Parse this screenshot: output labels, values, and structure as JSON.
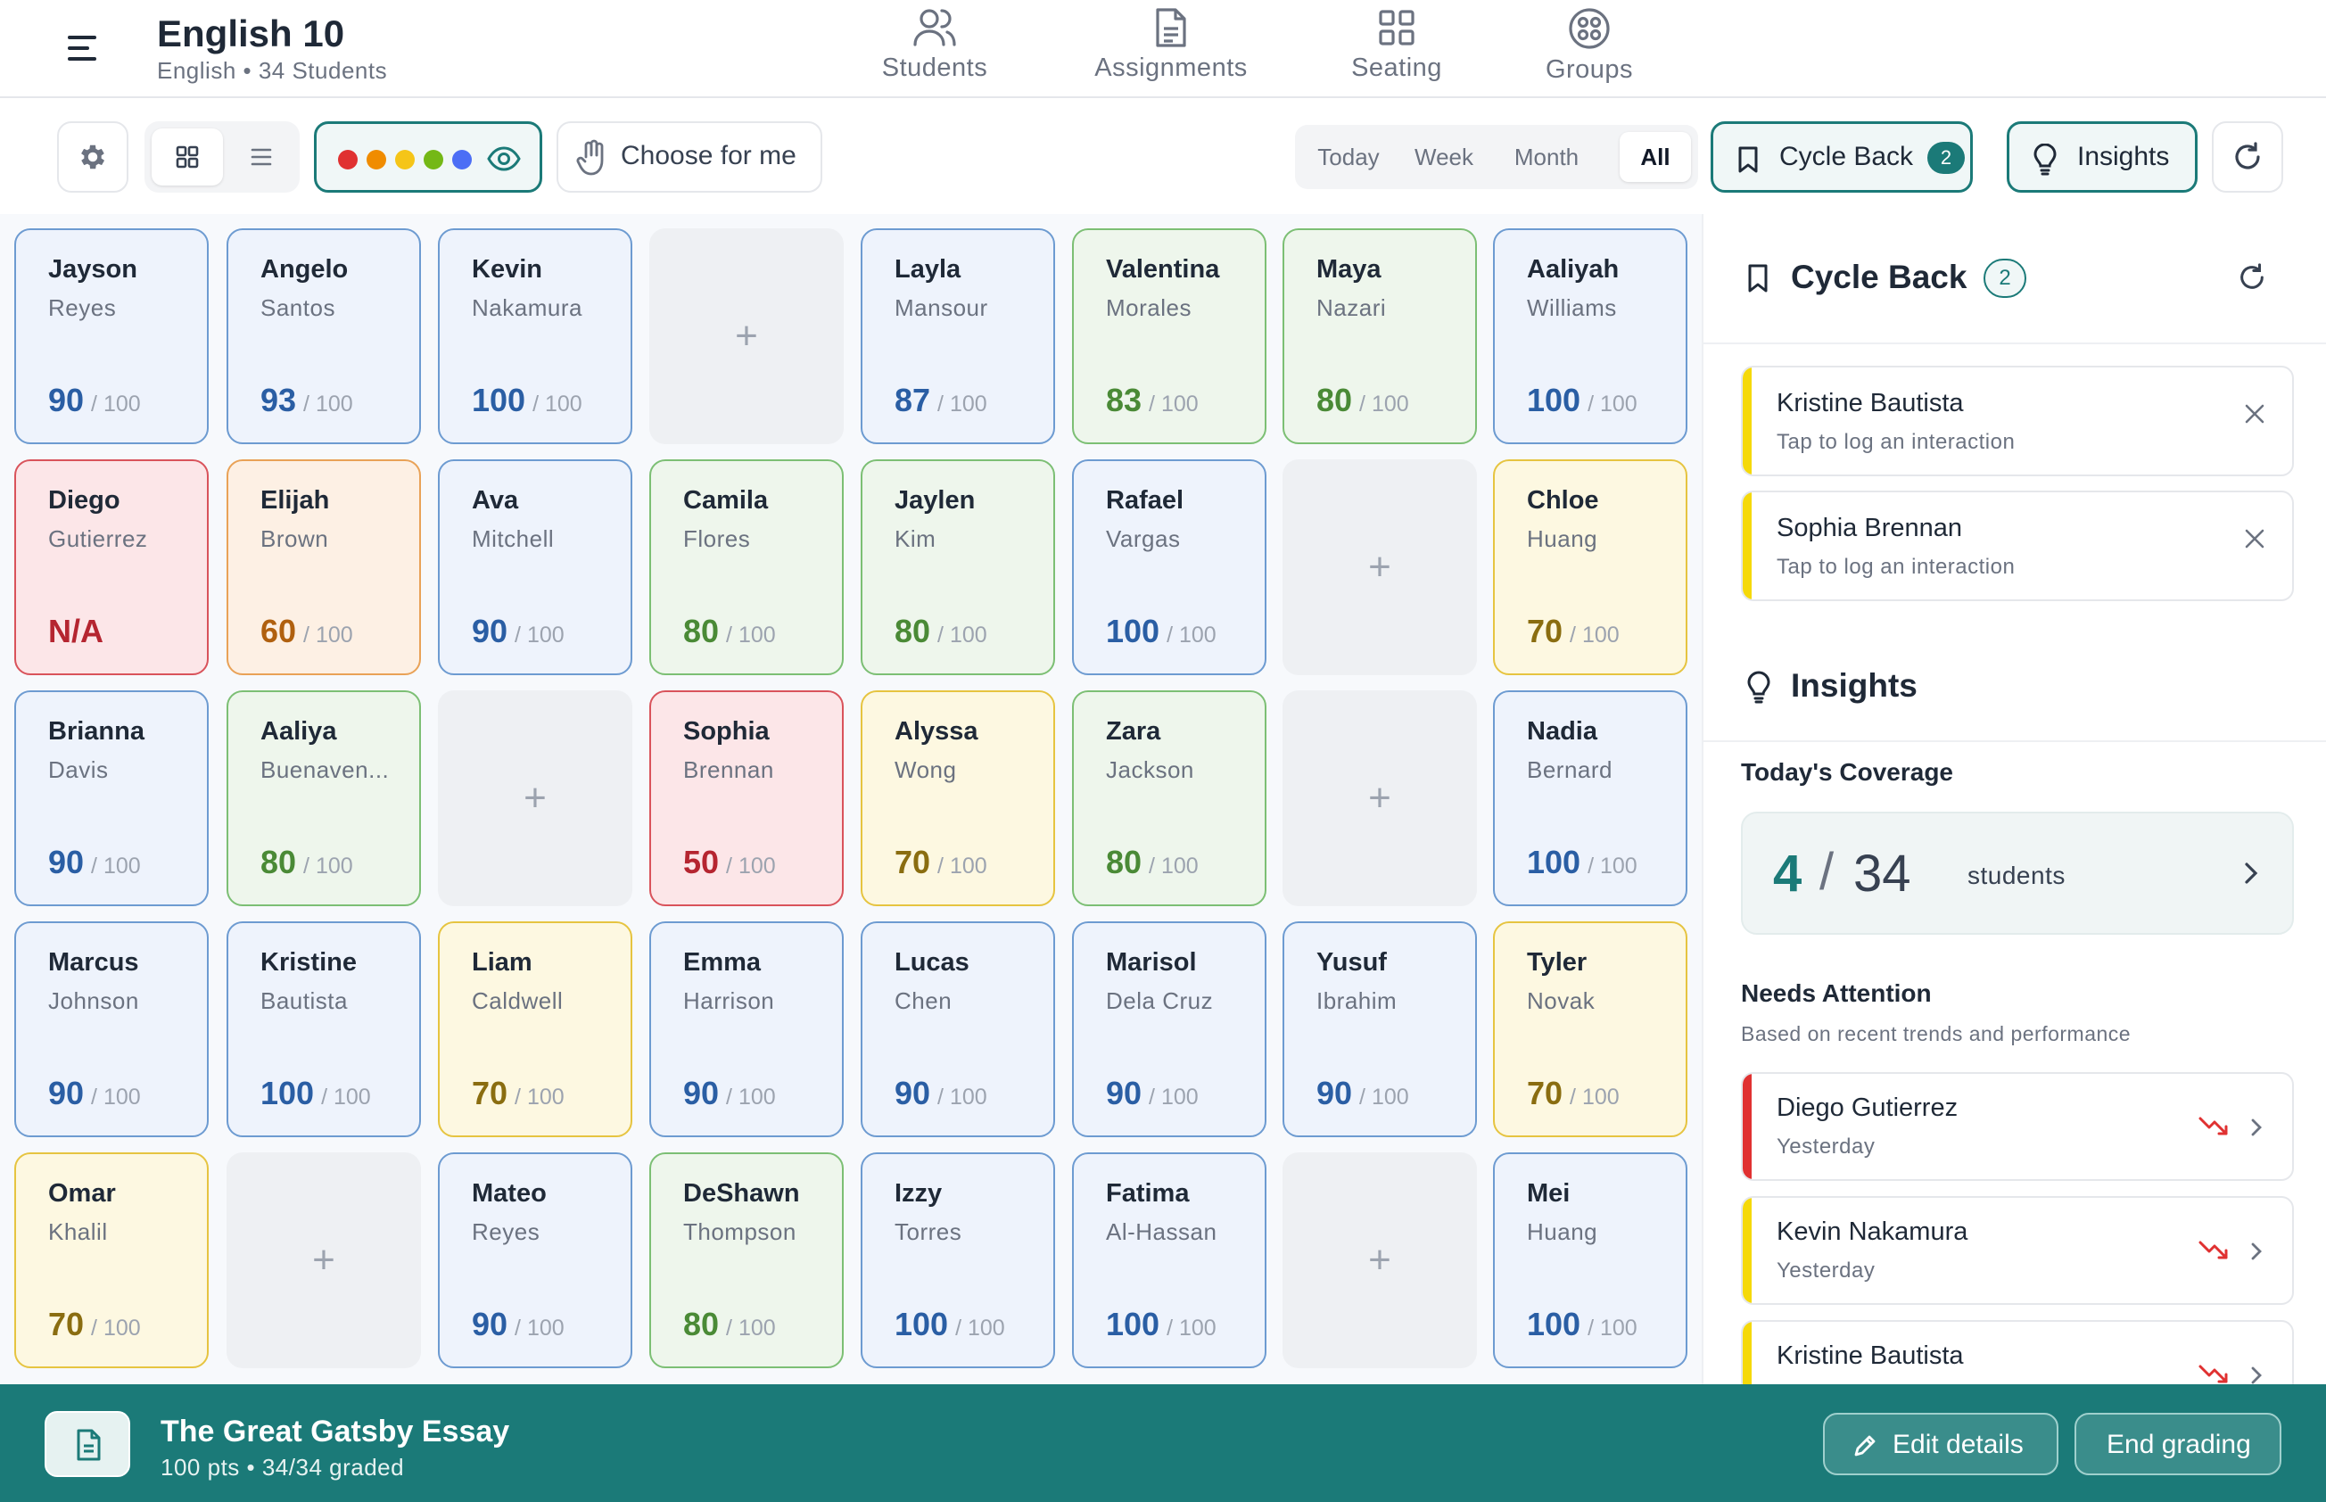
{
  "header": {
    "title": "English 10",
    "subtitle": "English • 34 Students",
    "tabs": [
      {
        "label": "Students",
        "icon": "users-icon"
      },
      {
        "label": "Assignments",
        "icon": "document-icon"
      },
      {
        "label": "Seating",
        "icon": "grid-icon"
      },
      {
        "label": "Groups",
        "icon": "groups-icon"
      }
    ]
  },
  "toolbar": {
    "choose_label": "Choose for me",
    "filter_colors": [
      "#e03131",
      "#f08c00",
      "#f5c518",
      "#74b816",
      "#4c6ef5"
    ],
    "ranges": [
      {
        "label": "Today",
        "active": false
      },
      {
        "label": "Week",
        "active": false
      },
      {
        "label": "Month",
        "active": false
      },
      {
        "label": "All",
        "active": true
      }
    ],
    "cycle_back_label": "Cycle Back",
    "cycle_back_count": "2",
    "insights_label": "Insights"
  },
  "grid": {
    "max_label": "/ 100",
    "plus_label": "+",
    "cells": [
      {
        "first": "Jayson",
        "last": "Reyes",
        "score": "90",
        "color": "blue"
      },
      {
        "first": "Angelo",
        "last": "Santos",
        "score": "93",
        "color": "blue"
      },
      {
        "first": "Kevin",
        "last": "Nakamura",
        "score": "100",
        "color": "blue"
      },
      {
        "empty": true
      },
      {
        "first": "Layla",
        "last": "Mansour",
        "score": "87",
        "color": "blue"
      },
      {
        "first": "Valentina",
        "last": "Morales",
        "score": "83",
        "color": "green"
      },
      {
        "first": "Maya",
        "last": "Nazari",
        "score": "80",
        "color": "green"
      },
      {
        "first": "Aaliyah",
        "last": "Williams",
        "score": "100",
        "color": "blue"
      },
      {
        "first": "Diego",
        "last": "Gutierrez",
        "score": "N/A",
        "color": "red",
        "na": true
      },
      {
        "first": "Elijah",
        "last": "Brown",
        "score": "60",
        "color": "orange"
      },
      {
        "first": "Ava",
        "last": "Mitchell",
        "score": "90",
        "color": "blue"
      },
      {
        "first": "Camila",
        "last": "Flores",
        "score": "80",
        "color": "green"
      },
      {
        "first": "Jaylen",
        "last": "Kim",
        "score": "80",
        "color": "green"
      },
      {
        "first": "Rafael",
        "last": "Vargas",
        "score": "100",
        "color": "blue"
      },
      {
        "empty": true
      },
      {
        "first": "Chloe",
        "last": "Huang",
        "score": "70",
        "color": "yellow"
      },
      {
        "first": "Brianna",
        "last": "Davis",
        "score": "90",
        "color": "blue"
      },
      {
        "first": "Aaliya",
        "last": "Buenaven...",
        "score": "80",
        "color": "green"
      },
      {
        "empty": true
      },
      {
        "first": "Sophia",
        "last": "Brennan",
        "score": "50",
        "color": "red"
      },
      {
        "first": "Alyssa",
        "last": "Wong",
        "score": "70",
        "color": "yellow"
      },
      {
        "first": "Zara",
        "last": "Jackson",
        "score": "80",
        "color": "green"
      },
      {
        "empty": true
      },
      {
        "first": "Nadia",
        "last": "Bernard",
        "score": "100",
        "color": "blue"
      },
      {
        "first": "Marcus",
        "last": "Johnson",
        "score": "90",
        "color": "blue"
      },
      {
        "first": "Kristine",
        "last": "Bautista",
        "score": "100",
        "color": "blue"
      },
      {
        "first": "Liam",
        "last": "Caldwell",
        "score": "70",
        "color": "yellow"
      },
      {
        "first": "Emma",
        "last": "Harrison",
        "score": "90",
        "color": "blue"
      },
      {
        "first": "Lucas",
        "last": "Chen",
        "score": "90",
        "color": "blue"
      },
      {
        "first": "Marisol",
        "last": "Dela Cruz",
        "score": "90",
        "color": "blue"
      },
      {
        "first": "Yusuf",
        "last": "Ibrahim",
        "score": "90",
        "color": "blue"
      },
      {
        "first": "Tyler",
        "last": "Novak",
        "score": "70",
        "color": "yellow"
      },
      {
        "first": "Omar",
        "last": "Khalil",
        "score": "70",
        "color": "yellow"
      },
      {
        "empty": true
      },
      {
        "first": "Mateo",
        "last": "Reyes",
        "score": "90",
        "color": "blue"
      },
      {
        "first": "DeShawn",
        "last": "Thompson",
        "score": "80",
        "color": "green"
      },
      {
        "first": "Izzy",
        "last": "Torres",
        "score": "100",
        "color": "blue"
      },
      {
        "first": "Fatima",
        "last": "Al-Hassan",
        "score": "100",
        "color": "blue"
      },
      {
        "empty": true
      },
      {
        "first": "Mei",
        "last": "Huang",
        "score": "100",
        "color": "blue"
      }
    ]
  },
  "panel": {
    "cycle_back": {
      "title": "Cycle Back",
      "count": "2",
      "items": [
        {
          "name": "Kristine Bautista",
          "sub": "Tap to log an interaction"
        },
        {
          "name": "Sophia Brennan",
          "sub": "Tap to log an interaction"
        }
      ]
    },
    "insights": {
      "title": "Insights",
      "coverage_label": "Today's Coverage",
      "coverage_count": "4",
      "coverage_sep": "/",
      "coverage_total": "34",
      "coverage_unit": "students",
      "needs_title": "Needs Attention",
      "needs_sub": "Based on recent trends and performance",
      "needs": [
        {
          "name": "Diego Gutierrez",
          "when": "Yesterday",
          "color": "#e03131"
        },
        {
          "name": "Kevin Nakamura",
          "when": "Yesterday",
          "color": "#f5d90a"
        },
        {
          "name": "Kristine Bautista",
          "when": "",
          "color": "#f5d90a"
        }
      ]
    }
  },
  "footer": {
    "assignment_title": "The Great Gatsby Essay",
    "assignment_sub": "100 pts  •  34/34 graded",
    "edit_label": "Edit details",
    "end_label": "End grading"
  },
  "colors": {
    "accent": "#1b7a78",
    "trend_down": "#e03131"
  }
}
